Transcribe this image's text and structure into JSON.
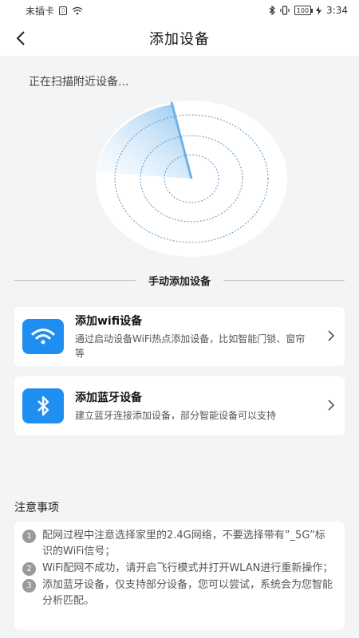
{
  "status_bar": {
    "carrier": "未插卡",
    "battery": "100",
    "time": "3:34"
  },
  "header": {
    "title": "添加设备"
  },
  "scan": {
    "status_text": "正在扫描附近设备..."
  },
  "manual": {
    "section_label": "手动添加设备",
    "cards": [
      {
        "title": "添加wifi设备",
        "desc": "通过启动设备WiFi热点添加设备，比如智能门锁、窗帘等",
        "icon": "wifi-icon"
      },
      {
        "title": "添加蓝牙设备",
        "desc": "建立蓝牙连接添加设备，部分智能设备可以支持",
        "icon": "bluetooth-icon"
      }
    ]
  },
  "notes": {
    "title": "注意事项",
    "items": [
      {
        "num": "1",
        "text": "配网过程中注意选择家里的2.4G网络，不要选择带有”_5G”标识的WiFi信号；"
      },
      {
        "num": "2",
        "text": "WiFi配网不成功，请开启飞行模式并打开WLAN进行重新操作；"
      },
      {
        "num": "3",
        "text": "添加蓝牙设备，仅支持部分设备，您可以尝试，系统会为您智能分析匹配。"
      }
    ]
  },
  "colors": {
    "accent": "#1e8ef0",
    "background": "#f3f4f6",
    "radar_ring": "#4a90c8"
  }
}
